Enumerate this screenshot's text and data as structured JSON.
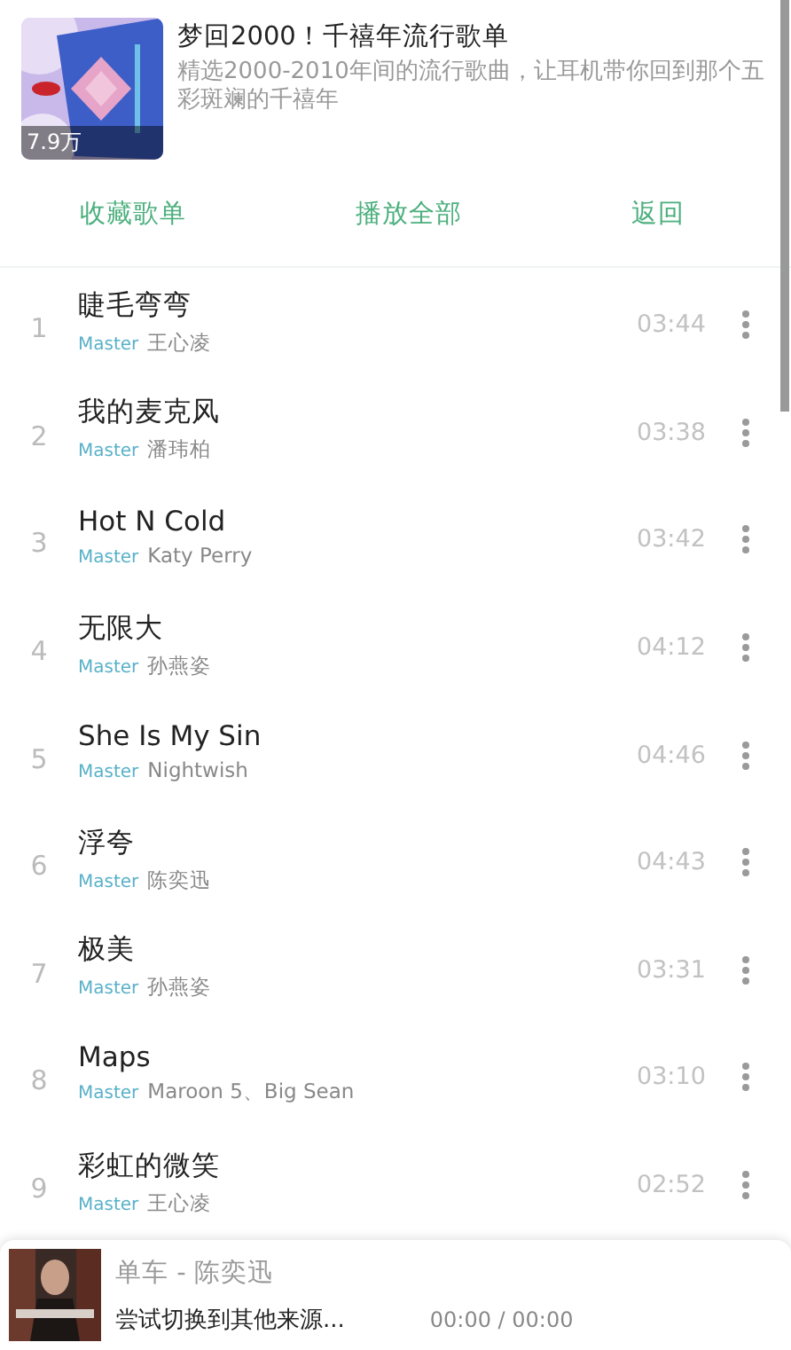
{
  "playlist": {
    "play_count": "7.9万",
    "title": "梦回2000！千禧年流行歌单",
    "description": "精选2000-2010年间的流行歌曲，让耳机带你回到那个五彩斑斓的千禧年"
  },
  "actions": [
    "收藏歌单",
    "播放全部",
    "返回"
  ],
  "songs": [
    {
      "index": "1",
      "title": "睫毛弯弯",
      "quality": "Master",
      "artist": "王心凌",
      "duration": "03:44"
    },
    {
      "index": "2",
      "title": "我的麦克风",
      "quality": "Master",
      "artist": "潘玮柏",
      "duration": "03:38"
    },
    {
      "index": "3",
      "title": "Hot N Cold",
      "quality": "Master",
      "artist": "Katy Perry",
      "duration": "03:42"
    },
    {
      "index": "4",
      "title": "无限大",
      "quality": "Master",
      "artist": "孙燕姿",
      "duration": "04:12"
    },
    {
      "index": "5",
      "title": "She Is My Sin",
      "quality": "Master",
      "artist": "Nightwish",
      "duration": "04:46"
    },
    {
      "index": "6",
      "title": "浮夸",
      "quality": "Master",
      "artist": "陈奕迅",
      "duration": "04:43"
    },
    {
      "index": "7",
      "title": "极美",
      "quality": "Master",
      "artist": "孙燕姿",
      "duration": "03:31"
    },
    {
      "index": "8",
      "title": "Maps",
      "quality": "Master",
      "artist": "Maroon 5、Big Sean",
      "duration": "03:10"
    },
    {
      "index": "9",
      "title": "彩虹的微笑",
      "quality": "Master",
      "artist": "王心凌",
      "duration": "02:52"
    }
  ],
  "player": {
    "track": "单车 - 陈奕迅",
    "status": "尝试切换到其他来源...",
    "time": "00:00 / 00:00"
  }
}
